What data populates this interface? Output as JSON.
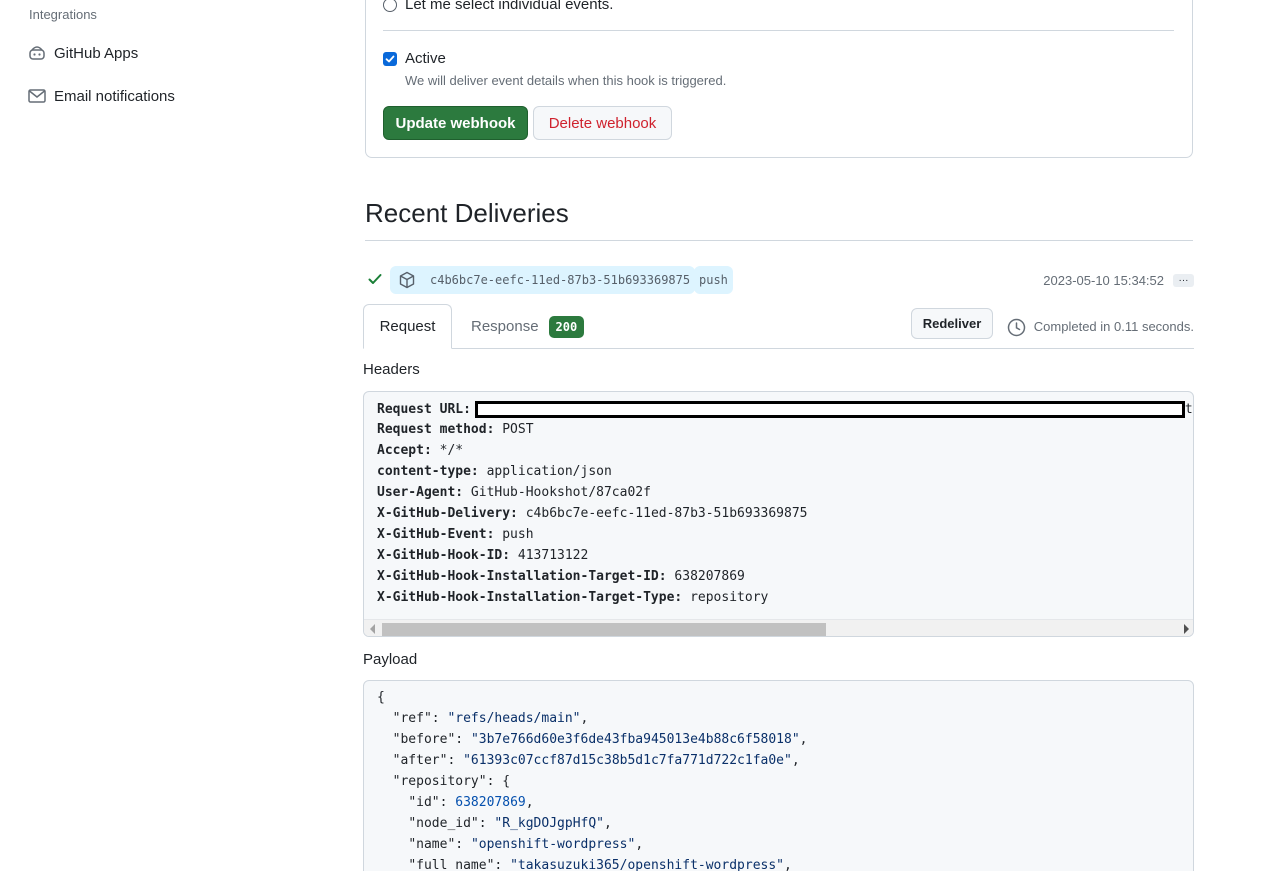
{
  "sidebar": {
    "heading": "Integrations",
    "items": [
      {
        "label": "GitHub Apps",
        "icon": "robot-icon"
      },
      {
        "label": "Email notifications",
        "icon": "mail-icon"
      }
    ]
  },
  "settings": {
    "radio_label": "Let me select individual events.",
    "active_label": "Active",
    "active_checked": true,
    "active_note": "We will deliver event details when this hook is triggered.",
    "update_button": "Update webhook",
    "delete_button": "Delete webhook"
  },
  "recent_deliveries": {
    "title": "Recent Deliveries",
    "delivery": {
      "status": "success",
      "guid": "c4b6bc7e-eefc-11ed-87b3-51b693369875",
      "event": "push",
      "timestamp": "2023-05-10 15:34:52",
      "more": "···"
    },
    "tabs": {
      "request": "Request",
      "response": "Response",
      "response_code": "200"
    },
    "redeliver": "Redeliver",
    "completed": "Completed in 0.11 seconds."
  },
  "headers": {
    "title": "Headers",
    "lines": [
      {
        "key": "Request URL:",
        "value": "",
        "redacted": true,
        "overflow": "t"
      },
      {
        "key": "Request method:",
        "value": "POST"
      },
      {
        "key": "Accept:",
        "value": "*/*"
      },
      {
        "key": "content-type:",
        "value": "application/json"
      },
      {
        "key": "User-Agent:",
        "value": "GitHub-Hookshot/87ca02f"
      },
      {
        "key": "X-GitHub-Delivery:",
        "value": "c4b6bc7e-eefc-11ed-87b3-51b693369875"
      },
      {
        "key": "X-GitHub-Event:",
        "value": "push"
      },
      {
        "key": "X-GitHub-Hook-ID:",
        "value": "413713122"
      },
      {
        "key": "X-GitHub-Hook-Installation-Target-ID:",
        "value": "638207869"
      },
      {
        "key": "X-GitHub-Hook-Installation-Target-Type:",
        "value": "repository"
      }
    ]
  },
  "payload": {
    "title": "Payload",
    "lines": [
      "{",
      "  \"ref\": \"refs/heads/main\",",
      "  \"before\": \"3b7e766d60e3f6de43fba945013e4b88c6f58018\",",
      "  \"after\": \"61393c07ccf87d15c38b5d1c7fa771d722c1fa0e\",",
      "  \"repository\": {",
      "    \"id\": 638207869,",
      "    \"node_id\": \"R_kgDOJgpHfQ\",",
      "    \"name\": \"openshift-wordpress\",",
      "    \"full_name\": \"takasuzuki365/openshift-wordpress\","
    ]
  },
  "colors": {
    "primary_green": "#2c7a3e",
    "danger_red": "#cf222e",
    "link_blue": "#0969da",
    "pill_bg": "#ddf4ff"
  }
}
